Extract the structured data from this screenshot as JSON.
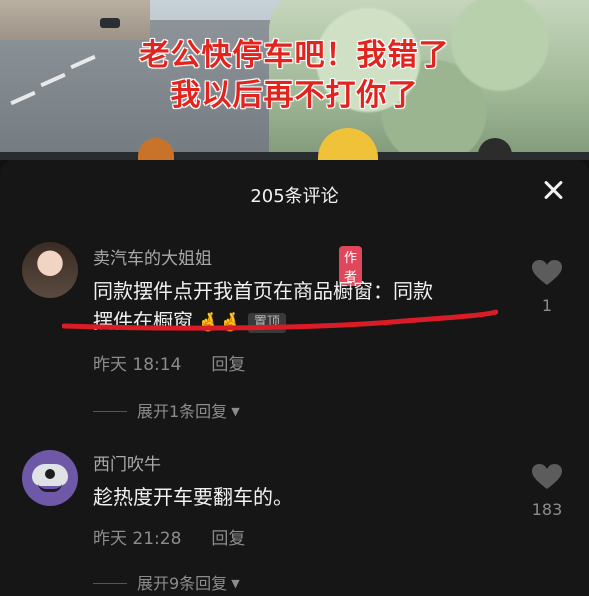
{
  "video": {
    "caption_line1": "老公快停车吧！我错了",
    "caption_line2": "我以后再不打你了"
  },
  "panel": {
    "title": "205条评论",
    "close_icon": "close-icon"
  },
  "comments": [
    {
      "username": "卖汽车的大姐姐",
      "badge": "作者",
      "text_line1": "同款摆件点开我首页在商品橱窗：同款",
      "text_line2": "摆件在橱窗",
      "emojis": "🤞🤞",
      "pin_label": "置顶",
      "time": "昨天 18:14",
      "reply_label": "回复",
      "likes": "1",
      "expand_label": "展开1条回复"
    },
    {
      "username": "西门吹牛",
      "text": "趁热度开车要翻车的。",
      "time": "昨天 21:28",
      "reply_label": "回复",
      "likes": "183",
      "expand_label": "展开9条回复"
    }
  ],
  "colors": {
    "caption_red": "#e2241f",
    "badge_pink": "#e0475a",
    "underline_red": "#d91c26"
  }
}
